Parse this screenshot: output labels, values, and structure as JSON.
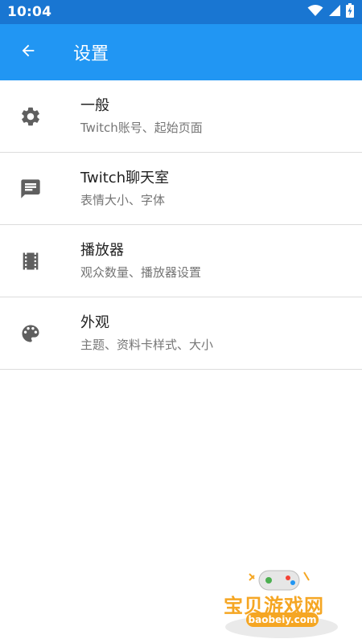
{
  "status_bar": {
    "time": "10:04"
  },
  "app_bar": {
    "title": "设置"
  },
  "settings": [
    {
      "title": "一般",
      "subtitle": "Twitch账号、起始页面",
      "icon": "gear-icon"
    },
    {
      "title": "Twitch聊天室",
      "subtitle": "表情大小、字体",
      "icon": "chat-icon"
    },
    {
      "title": "播放器",
      "subtitle": "观众数量、播放器设置",
      "icon": "film-icon"
    },
    {
      "title": "外观",
      "subtitle": "主题、资料卡样式、大小",
      "icon": "palette-icon"
    }
  ],
  "watermark": {
    "text": "宝贝游戏网",
    "domain": "baobeiy.com"
  },
  "colors": {
    "status_bar": "#1976d2",
    "app_bar": "#2196f3",
    "icon": "#5f5f5f",
    "watermark": "#f5a623"
  }
}
